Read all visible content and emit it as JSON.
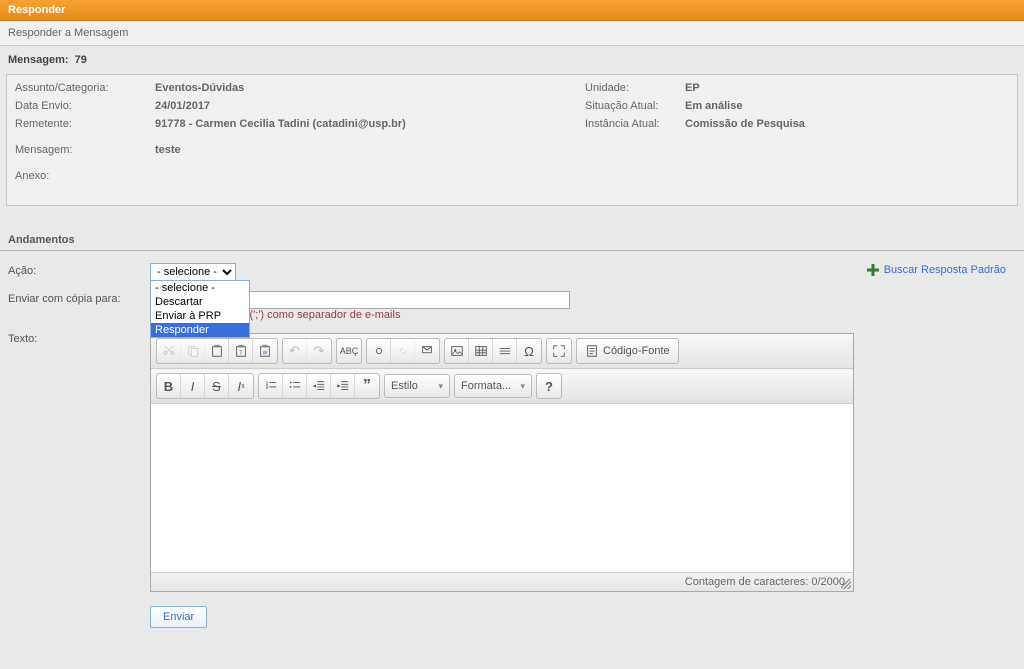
{
  "header": {
    "title": "Responder"
  },
  "subheader": {
    "text": "Responder a Mensagem"
  },
  "msg_header": {
    "label": "Mensagem:",
    "id": "79"
  },
  "details": {
    "assunto_lbl": "Assunto/Categoria:",
    "assunto_val": "Eventos-Dúvidas",
    "data_lbl": "Data Envio:",
    "data_val": "24/01/2017",
    "remetente_lbl": "Remetente:",
    "remetente_val": "91778 - Carmen Cecilia Tadini (catadini@usp.br)",
    "unidade_lbl": "Unidade:",
    "unidade_val": "EP",
    "situacao_lbl": "Situação Atual:",
    "situacao_val": "Em análise",
    "instancia_lbl": "Instância Atual:",
    "instancia_val": "Comissão de Pesquisa",
    "mensagem_lbl": "Mensagem:",
    "mensagem_val": "teste",
    "anexo_lbl": "Anexo:"
  },
  "andamentos": {
    "title": "Andamentos"
  },
  "form": {
    "acao_lbl": "Ação:",
    "acao_selected": "- selecione -",
    "acao_options": [
      "- selecione -",
      "Descartar",
      "Enviar à PRP",
      "Responder"
    ],
    "acao_highlight": "Responder",
    "cc_lbl": "Enviar com cópia para:",
    "cc_hint": "rgula (';') como separador de e-mails",
    "texto_lbl": "Texto:",
    "buscar_default": "Buscar Resposta Padrão"
  },
  "toolbar": {
    "source": "Código-Fonte",
    "style": "Estilo",
    "format": "Formata...",
    "help": "?"
  },
  "footer": {
    "counter": "Contagem de caracteres: 0/2000"
  },
  "actions": {
    "send": "Enviar"
  }
}
